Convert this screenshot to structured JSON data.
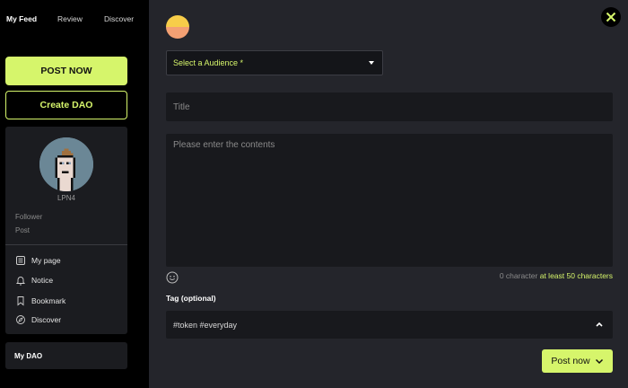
{
  "sidebar": {
    "tabs": [
      {
        "label": "My Feed"
      },
      {
        "label": "Review"
      },
      {
        "label": "Discover"
      }
    ],
    "post_now_label": "POST NOW",
    "create_dao_label": "Create DAO",
    "profile": {
      "username": "LPN4",
      "follower_label": "Follower",
      "post_label": "Post"
    },
    "menu": [
      {
        "label": "My page",
        "icon": "page-icon"
      },
      {
        "label": "Notice",
        "icon": "bell-icon"
      },
      {
        "label": "Bookmark",
        "icon": "bookmark-icon"
      },
      {
        "label": "Discover",
        "icon": "compass-icon"
      }
    ],
    "my_dao_label": "My DAO"
  },
  "composer": {
    "audience_placeholder": "Select a Audience *",
    "title_placeholder": "Title",
    "content_placeholder": "Please enter the contents",
    "counter_text": "0 character",
    "counter_min": "at least 50 characters",
    "tag_label": "Tag (optional)",
    "tag_value": "#token #everyday",
    "post_button_label": "Post now"
  },
  "colors": {
    "accent": "#d6f56b",
    "panel_bg": "#24252b",
    "input_bg": "#18191d",
    "sidebar_card_bg": "#1b1c20"
  }
}
